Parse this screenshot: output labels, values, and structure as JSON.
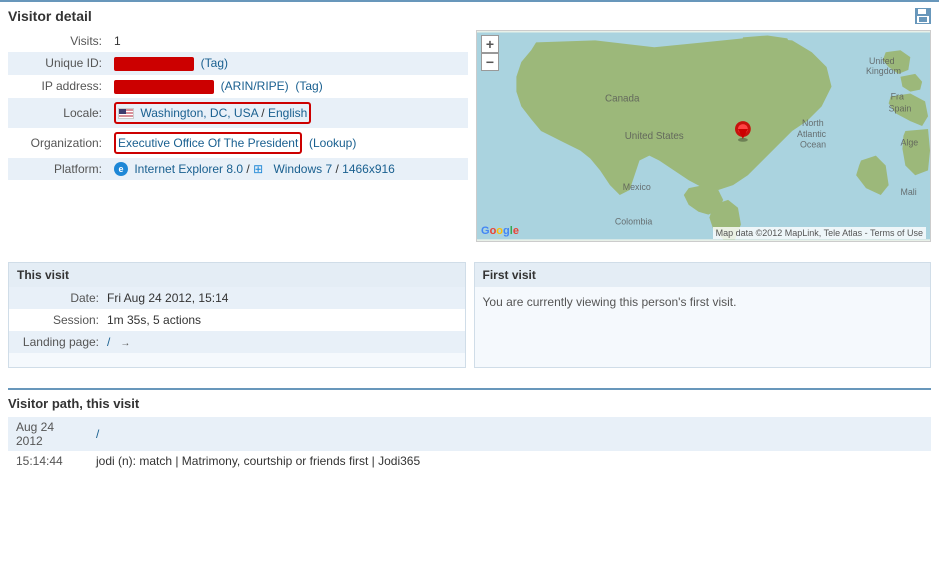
{
  "page": {
    "title": "Visitor detail"
  },
  "visitor": {
    "visits_label": "Visits:",
    "visits_value": "1",
    "unique_id_label": "Unique ID:",
    "unique_id_tag": "(Tag)",
    "ip_label": "IP address:",
    "ip_links": "(ARIN/RIPE)",
    "ip_tag": "(Tag)",
    "locale_label": "Locale:",
    "locale_location": "Washington, DC, USA",
    "locale_separator": " / ",
    "locale_language": "English",
    "org_label": "Organization:",
    "org_name": "Executive Office Of The President",
    "org_lookup": "(Lookup)",
    "platform_label": "Platform:",
    "platform_browser": "Internet Explorer 8.0",
    "platform_separator1": " / ",
    "platform_os": "Windows 7",
    "platform_separator2": " / ",
    "platform_resolution": "1466x916"
  },
  "this_visit": {
    "header": "This visit",
    "date_label": "Date:",
    "date_value": "Fri Aug 24 2012, 15:14",
    "session_label": "Session:",
    "session_value": "1m 35s, 5 actions",
    "landing_label": "Landing page:",
    "landing_value": "/"
  },
  "first_visit": {
    "header": "First visit",
    "message": "You are currently viewing this person's first visit."
  },
  "visitor_path": {
    "header": "Visitor path, this visit",
    "rows": [
      {
        "col1": "Aug 24 2012",
        "col2": "/"
      },
      {
        "col1": "15:14:44",
        "col2": "jodi (n): match | Matrimony, courtship or friends first | Jodi365"
      }
    ]
  },
  "map": {
    "attribution": "Map data ©2012 MapLink, Tele Atlas - Terms of Use",
    "plus_label": "+",
    "minus_label": "−"
  }
}
